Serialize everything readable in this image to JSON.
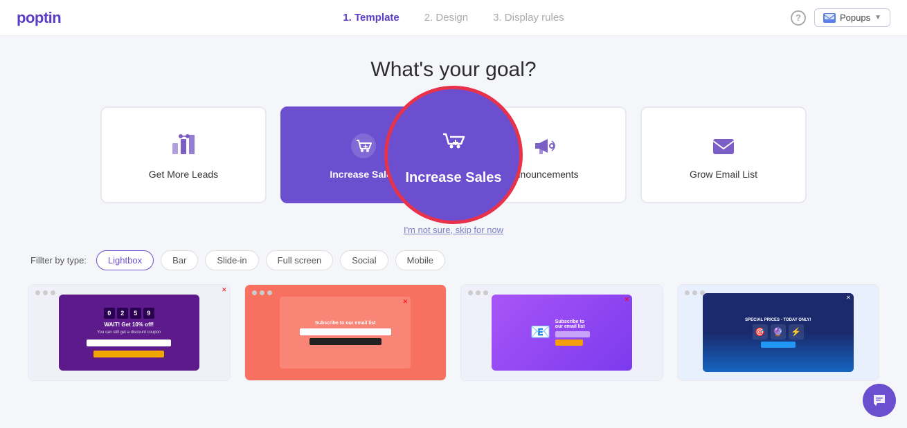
{
  "header": {
    "logo": "poptin",
    "steps": [
      {
        "label": "1. Template",
        "active": true
      },
      {
        "label": "2. Design",
        "active": false
      },
      {
        "label": "3. Display rules",
        "active": false
      }
    ],
    "help_label": "?",
    "popups_label": "Popups",
    "popups_icon": "inbox-icon"
  },
  "main": {
    "page_title": "What's your goal?",
    "goal_cards": [
      {
        "id": "get-more-leads",
        "label": "Get More Leads",
        "icon": "leads-icon",
        "selected": false
      },
      {
        "id": "increase-sales",
        "label": "Increase Sales",
        "icon": "cart-icon",
        "selected": true
      },
      {
        "id": "announcements",
        "label": "Announcements",
        "icon": "megaphone-icon",
        "selected": false
      },
      {
        "id": "grow-email-list",
        "label": "Grow Email List",
        "icon": "email-icon",
        "selected": false
      }
    ],
    "zoom_label": "Increase Sales",
    "skip_link_text": "I'm not sure, skip for now",
    "filter": {
      "label": "Fillter by type:",
      "options": [
        {
          "label": "Lightbox",
          "active": true
        },
        {
          "label": "Bar",
          "active": false
        },
        {
          "label": "Slide-in",
          "active": false
        },
        {
          "label": "Full screen",
          "active": false
        },
        {
          "label": "Social",
          "active": false
        },
        {
          "label": "Mobile",
          "active": false
        }
      ]
    },
    "templates": [
      {
        "id": "tpl-1",
        "type": "discount"
      },
      {
        "id": "tpl-2",
        "type": "email-subscribe"
      },
      {
        "id": "tpl-3",
        "type": "email-subscribe-2"
      },
      {
        "id": "tpl-4",
        "type": "special-prices"
      }
    ]
  }
}
